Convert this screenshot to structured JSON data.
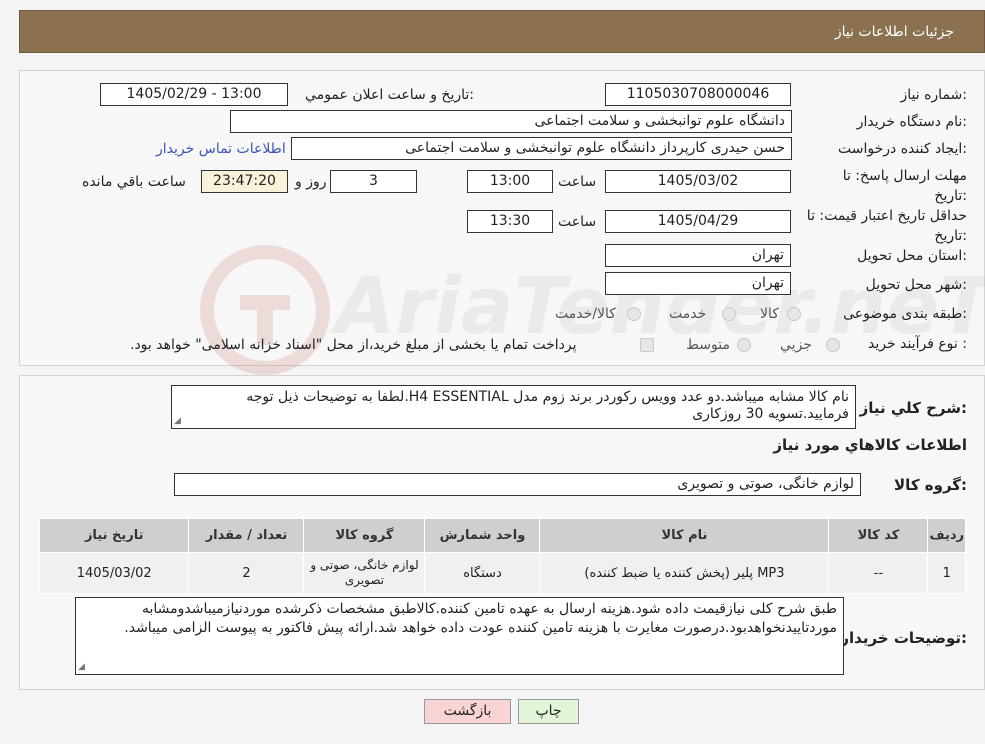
{
  "page_title": "جزئیات اطلاعات نیاز",
  "form": {
    "need_number_label": "شماره نیاز:",
    "need_number": "1105030708000046",
    "announce_label": "تاریخ و ساعت اعلان عمومي:",
    "announce_value": "1405/02/29 - 13:00",
    "buyer_label": "نام دستگاه خریدار:",
    "buyer_value": "دانشگاه علوم توانبخشی و سلامت اجتماعی",
    "creator_label": "ایجاد کننده درخواست:",
    "creator_value": "حسن حیدری کارپرداز دانشگاه علوم توانبخشی و سلامت اجتماعی",
    "contact_link": "اطلاعات تماس خریدار",
    "deadline_label": "مهلت ارسال پاسخ: تا تاریخ:",
    "deadline_date": "1405/03/02",
    "time_label": "ساعت",
    "deadline_time": "13:00",
    "days_value": "3",
    "days_label": "روز و",
    "remaining_value": "23:47:20",
    "remaining_label": "ساعت باقي مانده",
    "validity_label": "حداقل تاریخ اعتبار قیمت: تا تاریخ:",
    "validity_date": "1405/04/29",
    "validity_time_label": "ساعت",
    "validity_time": "13:30",
    "province_label": "استان محل تحویل:",
    "province_value": "تهران",
    "city_label": "شهر محل تحویل:",
    "city_value": "تهران",
    "category_label": "طبقه بندی موضوعی:",
    "category_options": [
      "کالا",
      "خدمت",
      "کالا/خدمت"
    ],
    "process_label": "نوع فرآیند خرید :",
    "process_options": [
      "جزیي",
      "متوسط"
    ],
    "process_note": "پرداخت تمام یا بخشی از مبلغ خرید،از محل \"اسناد خزانه اسلامی\" خواهد بود."
  },
  "description": {
    "label": "شرح کلي نیاز:",
    "text": "نام کالا مشابه میباشد.دو عدد وویس رکوردر برند زوم مدل H4 ESSENTIAL.لطفا به توضیحات ذیل توجه فرمایید.تسویه 30 روزکاری"
  },
  "goods_section_title": "اطلاعات کالاهاي مورد نیاز",
  "goods_group": {
    "label": "گروه کالا:",
    "value": "لوازم خانگی، صوتی و تصویری"
  },
  "table": {
    "headers": [
      "ردیف",
      "کد کالا",
      "نام کالا",
      "واحد شمارش",
      "گروه کالا",
      "تعداد / مقدار",
      "تاریخ نیاز"
    ],
    "rows": [
      [
        "1",
        "--",
        "MP3 پلیر (پخش کننده یا ضبط کننده)",
        "دستگاه",
        "لوازم خانگی، صوتی و تصویری",
        "2",
        "1405/03/02"
      ]
    ]
  },
  "buyer_notes": {
    "label": "توضیحات خریدار:",
    "text": "طبق شرح کلی نیازقیمت داده شود.هزینه ارسال به عهده تامین کننده.کالاطبق مشخصات ذکرشده موردنیازمیباشدومشابه موردتاییدنخواهدبود.درصورت مغایرت با هزینه تامین کننده عودت داده خواهد شد.ارائه پیش فاکتور به پیوست الزامی میباشد."
  },
  "buttons": {
    "print": "چاپ",
    "back": "بازگشت"
  },
  "colors": {
    "header_bg": "#8b7150",
    "link": "#3a55b8",
    "back_button_bg": "#f9d4d4",
    "print_button_bg": "#e2f5d8"
  }
}
